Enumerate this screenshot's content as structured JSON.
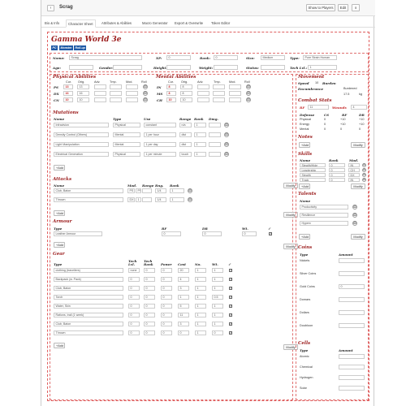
{
  "header": {
    "back_icon": "‹",
    "title": "Scrag",
    "show_players": "Show to Players",
    "edit": "Edit"
  },
  "tabs": [
    "Bio & Info",
    "Character Sheet",
    "Attributes & Abilities",
    "Macro Generator",
    "Export & Overwrite",
    "Token Editor"
  ],
  "sheet": {
    "title": "Gamma World 3e",
    "badges": [
      "PC",
      "Monster",
      "Roll-up"
    ],
    "basics": {
      "name_l": "Name:",
      "name_v": "Scrag",
      "xp_l": "XP:",
      "xp_v": "0",
      "rank_l": "Rank:",
      "rank_v": "0",
      "size_l": "Size:",
      "size_v": "Medium",
      "type_l": "Type:",
      "type_v": "Pure Strain Human",
      "age_l": "Age:",
      "gender_l": "Gender:",
      "height_l": "Height:",
      "weight_l": "Weight:",
      "status_l": "Status:",
      "tech_l": "Tech Lvl.:",
      "tech_v": "1"
    },
    "physical": {
      "title": "Physical Abilities",
      "cols": [
        "Cur.",
        "Orig.",
        "Adv.",
        "Tmp.",
        "Mod.",
        "Roll"
      ],
      "rows": [
        {
          "k": "PS",
          "cur": "13",
          "orig": "13"
        },
        {
          "k": "DX",
          "cur": "16",
          "orig": "16"
        },
        {
          "k": "CN",
          "cur": "10",
          "orig": "10"
        }
      ]
    },
    "mental": {
      "title": "Mental Abilities",
      "cols": [
        "Cur.",
        "Orig.",
        "Adv.",
        "Tmp.",
        "Mod.",
        "Roll"
      ],
      "rows": [
        {
          "k": "IN",
          "cur": "8",
          "orig": "8"
        },
        {
          "k": "MS",
          "cur": "8",
          "orig": "8"
        },
        {
          "k": "CH",
          "cur": "10",
          "orig": "10"
        }
      ]
    },
    "movement": {
      "title": "Movement",
      "speed_l": "Speed",
      "speed_v": "10",
      "burden_l": "Burden",
      "burden_v": "Burdened",
      "enc_l": "Encumbrance",
      "enc_v": "17.5",
      "enc_u": "kg"
    },
    "combat": {
      "title": "Combat Stats",
      "rf_l": "RF",
      "rf_v": "11",
      "wounds_l": "Wounds",
      "wounds_v": "4",
      "defcols": [
        "Defense",
        "CS",
        "RF",
        "DR"
      ],
      "defrows": [
        [
          "Physical",
          "0",
          "+10"
        ],
        [
          "Energy",
          "0",
          "+10"
        ],
        [
          "Mental",
          "0",
          "0"
        ]
      ]
    },
    "mutations": {
      "title": "Mutations",
      "cols": [
        "Name",
        "Type",
        "Use",
        "Range",
        "Rank",
        "Dmg."
      ],
      "rows": [
        [
          "Infravision",
          "Physical",
          "constant",
          "n/a",
          "1"
        ],
        [
          "Density Control (Others)",
          "Mental",
          "1 per hour",
          "dist",
          "1"
        ],
        [
          "Light Manipulation",
          "Mental",
          "1 per day",
          "dist",
          "1"
        ],
        [
          "Electrical Generation",
          "Physical",
          "1 per minute",
          "touch",
          "1"
        ]
      ],
      "add": "+Add",
      "modify": "Modify"
    },
    "attacks": {
      "title": "Attacks",
      "cols": [
        "Name",
        "Mod.",
        "Range",
        "Rng.",
        "Rank"
      ],
      "rows": [
        [
          "Club, Baton",
          "PS",
          "PS",
          "1/4",
          "1"
        ],
        [
          "Thrown",
          "DX",
          "1",
          "1/4",
          "1"
        ]
      ],
      "add": "+Add",
      "modify": "Modify"
    },
    "armour": {
      "title": "Armour",
      "cols": [
        "Type",
        "RF",
        "DR",
        "Wt.",
        "✓"
      ],
      "rows": [
        [
          "Leather Armour",
          "0",
          "0",
          "0"
        ]
      ],
      "add": "+Add",
      "modify": "Modify"
    },
    "gear": {
      "title": "Gear",
      "cols": [
        "Type",
        "Tech Lvl.",
        "Tech Rank",
        "Power",
        "Cost",
        "No.",
        "Wt.",
        "✓"
      ],
      "rows": [
        [
          "clothing (travellers)",
          "none",
          "0",
          "0",
          "20",
          "1",
          "1"
        ],
        [
          "Backpack (w. Pack)",
          "0",
          "0",
          "0",
          "4",
          "1",
          "1"
        ],
        [
          "Club, Baton",
          "0",
          "0",
          "0",
          "3",
          "1",
          "1"
        ],
        [
          "Torch",
          "0",
          "0",
          "0",
          "1",
          "1",
          "0.5"
        ],
        [
          "Water, Skin",
          "0",
          "0",
          "0",
          "5",
          "1",
          "1"
        ],
        [
          "Rations, trail (1 week)",
          "0",
          "0",
          "0",
          "11",
          "1",
          "1"
        ],
        [
          "Club, Baton",
          "0",
          "0",
          "0",
          "3",
          "1",
          "1"
        ],
        [
          "Thrown",
          "0",
          "0",
          "0",
          "0",
          "1",
          "0"
        ]
      ],
      "add": "+Add",
      "modify": "Modify"
    },
    "notes": {
      "title": "Notes",
      "add": "+Add",
      "modify": "Modify"
    },
    "skills": {
      "title": "Skills",
      "cols": [
        "Name",
        "Rank",
        "Mod."
      ],
      "rows": [
        [
          "Stealth/Hide",
          "0",
          "IN"
        ],
        [
          "Leadership",
          "0",
          "CH"
        ],
        [
          "Stealth",
          "0",
          "DX"
        ],
        [
          "Track",
          "0",
          "IN"
        ]
      ],
      "add": "+Add",
      "modify": "Modify"
    },
    "talents": {
      "title": "Talents",
      "cols": [
        "Name"
      ],
      "rows": [
        "Productivity",
        "Resilience",
        "Hyperx"
      ],
      "add": "+Add",
      "modify": "Modify"
    },
    "coins": {
      "title": "Coins",
      "cols": [
        "Type",
        "Amount"
      ],
      "rows": [
        [
          "Nickels",
          ""
        ],
        [
          "Silver Coins",
          ""
        ],
        [
          "Gold Coins",
          "0"
        ],
        [
          "Domars",
          ""
        ],
        [
          "Dollars",
          ""
        ],
        [
          "Doubloon",
          ""
        ]
      ]
    },
    "cells": {
      "title": "Cells",
      "cols": [
        "Type",
        "Amount"
      ],
      "rows": [
        [
          "Atomic",
          ""
        ],
        [
          "Chemical",
          ""
        ],
        [
          "Hydrogen",
          ""
        ],
        [
          "Solar",
          ""
        ]
      ]
    }
  }
}
